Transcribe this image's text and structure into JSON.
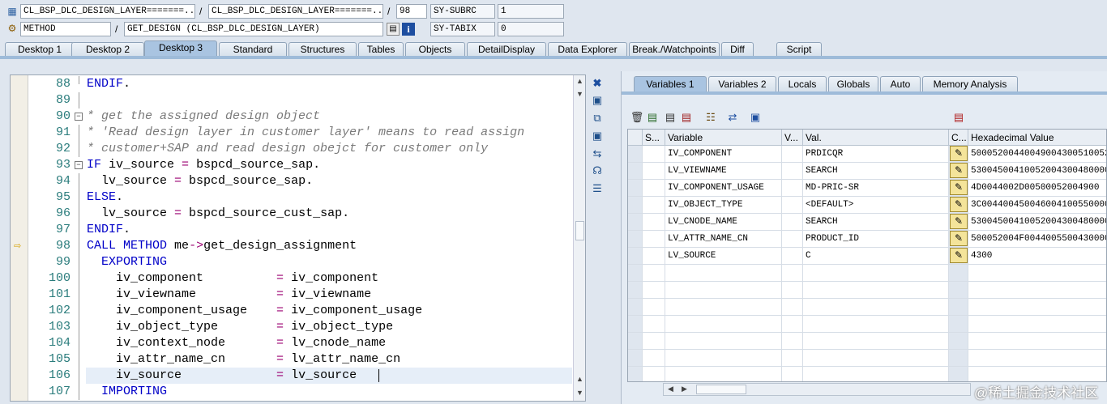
{
  "header": {
    "program_icon": "program-icon",
    "program_field": "CL_BSP_DLC_DESIGN_LAYER=======...",
    "include_field": "CL_BSP_DLC_DESIGN_LAYER=======...",
    "slash1": "/",
    "line_no": "98",
    "subrc_label": "SY-SUBRC",
    "subrc_value": "1",
    "type_icon": "method-icon",
    "type_field": "METHOD",
    "slash2": "/",
    "method_field": "GET_DESIGN (CL_BSP_DLC_DESIGN_LAYER)",
    "slash3": "/",
    "tabix_label": "SY-TABIX",
    "tabix_value": "0"
  },
  "tabs": [
    {
      "label": "Desktop 1"
    },
    {
      "label": "Desktop 2"
    },
    {
      "label": "Desktop 3",
      "active": true
    },
    {
      "label": "Standard"
    },
    {
      "label": "Structures"
    },
    {
      "label": "Tables"
    },
    {
      "label": "Objects"
    },
    {
      "label": "DetailDisplay"
    },
    {
      "label": "Data Explorer"
    },
    {
      "label": "Break./Watchpoints"
    },
    {
      "label": "Diff"
    },
    {
      "label": "Script"
    }
  ],
  "code": [
    {
      "n": "88",
      "text": "ENDIF."
    },
    {
      "n": "89",
      "text": ""
    },
    {
      "n": "90",
      "text": "* get the assigned design object"
    },
    {
      "n": "91",
      "text": "* 'Read design layer in customer layer' means to read assign"
    },
    {
      "n": "92",
      "text": "* customer+SAP and read design obejct for customer only"
    },
    {
      "n": "93",
      "text": "IF iv_source = bspcd_source_sap."
    },
    {
      "n": "94",
      "text": "  lv_source = bspcd_source_sap."
    },
    {
      "n": "95",
      "text": "ELSE."
    },
    {
      "n": "96",
      "text": "  lv_source = bspcd_source_cust_sap."
    },
    {
      "n": "97",
      "text": "ENDIF."
    },
    {
      "n": "98",
      "text": "CALL METHOD me->get_design_assignment"
    },
    {
      "n": "99",
      "text": "  EXPORTING"
    },
    {
      "n": "100",
      "text": "    iv_component          = iv_component"
    },
    {
      "n": "101",
      "text": "    iv_viewname           = iv_viewname"
    },
    {
      "n": "102",
      "text": "    iv_component_usage    = iv_component_usage"
    },
    {
      "n": "103",
      "text": "    iv_object_type        = iv_object_type"
    },
    {
      "n": "104",
      "text": "    iv_context_node       = lv_cnode_name"
    },
    {
      "n": "105",
      "text": "    iv_attr_name_cn       = lv_attr_name_cn"
    },
    {
      "n": "106",
      "text": "    iv_source             = lv_source"
    },
    {
      "n": "107",
      "text": "  IMPORTING"
    }
  ],
  "var_tabs": [
    {
      "label": "Variables 1",
      "active": true
    },
    {
      "label": "Variables 2"
    },
    {
      "label": "Locals"
    },
    {
      "label": "Globals"
    },
    {
      "label": "Auto"
    },
    {
      "label": "Memory Analysis"
    }
  ],
  "grid_headers": {
    "s": "S...",
    "variable": "Variable",
    "v": "V...",
    "val": "Val.",
    "c": "C...",
    "hex": "Hexadecimal Value"
  },
  "variables": [
    {
      "name": "IV_COMPONENT",
      "val": "PRDICQR",
      "hex": "50005200440049004300510052"
    },
    {
      "name": "LV_VIEWNAME",
      "val": "SEARCH",
      "hex": "53004500410052004300480000"
    },
    {
      "name": "IV_COMPONENT_USAGE",
      "val": "MD-PRIC-SR",
      "hex": "4D0044002D00500052004900"
    },
    {
      "name": "IV_OBJECT_TYPE",
      "val": "<DEFAULT>",
      "hex": "3C004400450046004100550000"
    },
    {
      "name": "LV_CNODE_NAME",
      "val": "SEARCH",
      "hex": "53004500410052004300480000"
    },
    {
      "name": "LV_ATTR_NAME_CN",
      "val": "PRODUCT_ID",
      "hex": "500052004F0044005500430000"
    },
    {
      "name": "LV_SOURCE",
      "val": "C",
      "hex": "4300"
    }
  ],
  "watermark": "@稀土掘金技术社区"
}
